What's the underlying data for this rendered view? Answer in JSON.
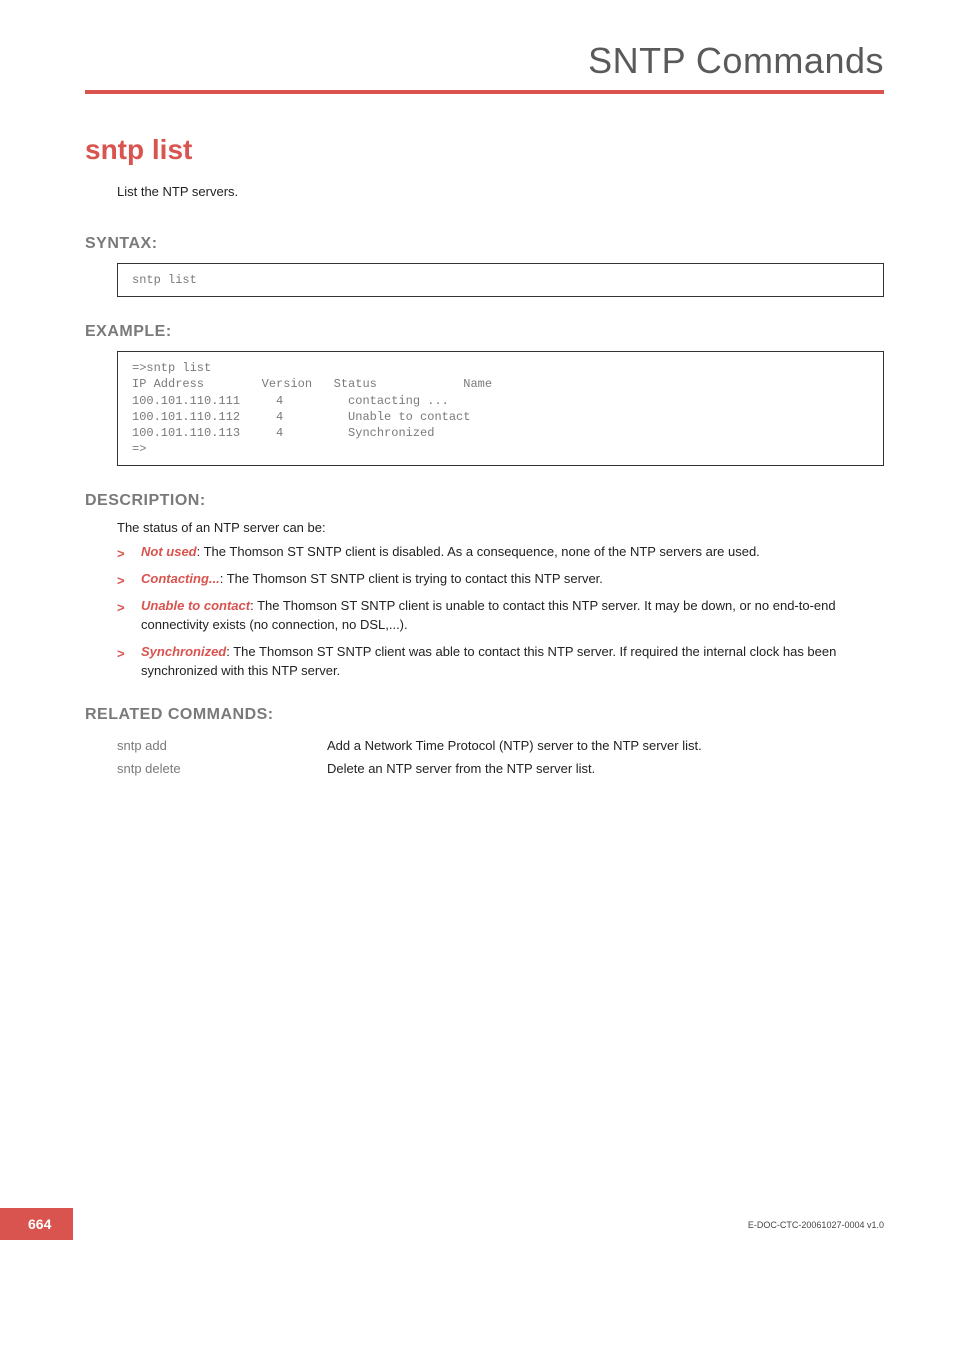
{
  "header": {
    "title": "SNTP Commands"
  },
  "command": {
    "title": "sntp list",
    "intro": "List the NTP servers."
  },
  "syntax": {
    "heading": "SYNTAX:",
    "code": "sntp list"
  },
  "example": {
    "heading": "EXAMPLE:",
    "code": "=>sntp list\nIP Address        Version   Status            Name\n100.101.110.111     4         contacting ...\n100.101.110.112     4         Unable to contact\n100.101.110.113     4         Synchronized\n=>"
  },
  "description": {
    "heading": "DESCRIPTION:",
    "intro": "The status of an NTP server can be:",
    "items": [
      {
        "term": "Not used",
        "text": ": The Thomson ST SNTP client is disabled. As a consequence, none of the NTP servers are used."
      },
      {
        "term": "Contacting...",
        "text": ": The Thomson ST SNTP client is trying to contact this NTP server."
      },
      {
        "term": "Unable to contact",
        "text": ": The Thomson ST SNTP client is unable to contact this NTP server. It may be down, or no end-to-end connectivity exists (no connection, no DSL,...)."
      },
      {
        "term": "Synchronized",
        "text": ": The Thomson ST SNTP client was able to contact this NTP server. If required the internal clock has been synchronized with this NTP server."
      }
    ]
  },
  "related": {
    "heading": "RELATED COMMANDS:",
    "rows": [
      {
        "cmd": "sntp add",
        "desc": "Add a Network Time Protocol (NTP) server to the NTP server list."
      },
      {
        "cmd": "sntp delete",
        "desc": "Delete an NTP server from the NTP server list."
      }
    ]
  },
  "footer": {
    "page": "664",
    "doc": "E-DOC-CTC-20061027-0004 v1.0"
  }
}
